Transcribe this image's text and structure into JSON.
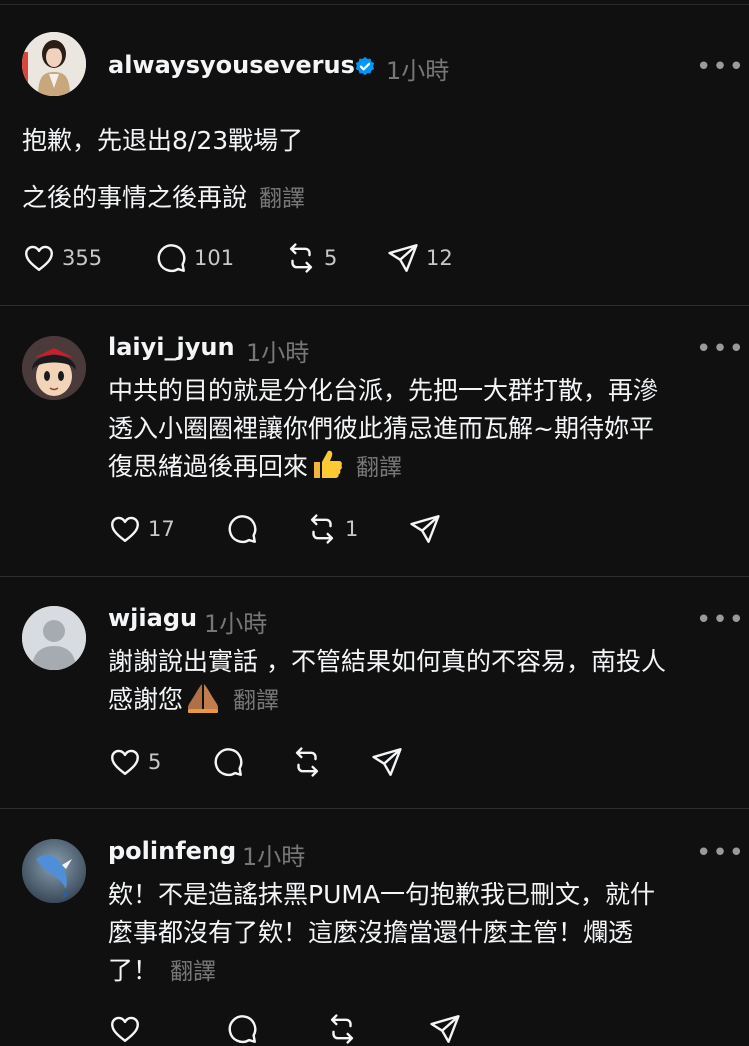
{
  "posts": [
    {
      "username": "alwaysyouseverus",
      "time": "1小時",
      "verified": true,
      "lines": [
        "抱歉，先退出8/23戰場了",
        "之後的事情之後再說"
      ],
      "translate": "翻譯",
      "likes": "355",
      "replies": "101",
      "reposts": "5",
      "shares": "12"
    },
    {
      "username": "laiyi_jyun",
      "time": "1小時",
      "lines": [
        "中共的目的就是分化台派，先把一大群打散，再滲",
        "透入小圈圈裡讓你們彼此猜忌進而瓦解~期待妳平",
        "復思緒過後再回來"
      ],
      "translate": "翻譯",
      "likes": "17",
      "replies": "",
      "reposts": "1",
      "shares": ""
    },
    {
      "username": "wjiagu",
      "time": "1小時",
      "lines": [
        "謝謝說出實話 ，不管結果如何真的不容易，南投人",
        "感謝您"
      ],
      "translate": "翻譯",
      "likes": "5",
      "replies": "",
      "reposts": "",
      "shares": ""
    },
    {
      "username": "polinfeng",
      "time": "1小時",
      "lines": [
        "欸！不是造謠抹黑PUMA一句抱歉我已刪文，就什",
        "麼事都沒有了欸！這麼沒擔當還什麼主管！爛透",
        "了！"
      ],
      "translate": "翻譯"
    }
  ],
  "more_glyph": "•••",
  "colors": {
    "background": "#101010",
    "text": "#f3f5f7",
    "muted": "#777777",
    "verified": "#0095f6"
  }
}
